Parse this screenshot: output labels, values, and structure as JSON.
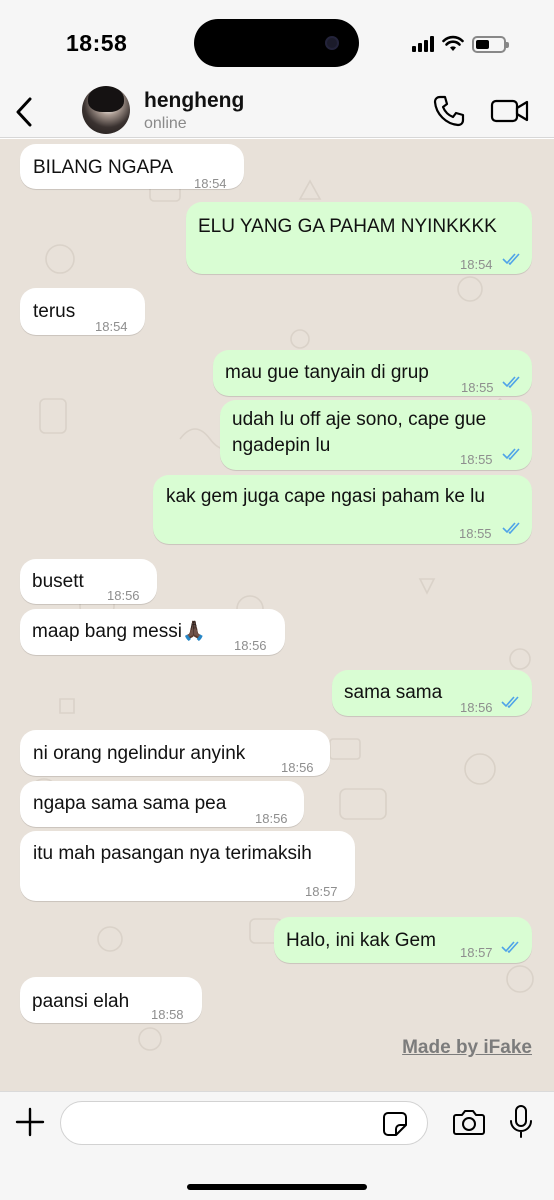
{
  "status_bar": {
    "time": "18:58"
  },
  "header": {
    "contact_name": "hengheng",
    "contact_status": "online"
  },
  "messages": [
    {
      "dir": "in",
      "text": "BILANG NGAPA",
      "time": "18:54"
    },
    {
      "dir": "out",
      "text": "ELU YANG GA PAHAM NYINKKKK",
      "time": "18:54"
    },
    {
      "dir": "in",
      "text": "terus",
      "time": "18:54"
    },
    {
      "dir": "out",
      "text": "mau gue tanyain di grup",
      "time": "18:55"
    },
    {
      "dir": "out",
      "line1": "udah lu off aje sono, cape gue",
      "line2": "ngadepin lu",
      "time": "18:55"
    },
    {
      "dir": "out",
      "text": "kak gem juga cape ngasi paham ke lu",
      "time": "18:55"
    },
    {
      "dir": "in",
      "text": "busett",
      "time": "18:56"
    },
    {
      "dir": "in",
      "text": "maap bang messi🙏🏿",
      "time": "18:56"
    },
    {
      "dir": "out",
      "text": "sama sama",
      "time": "18:56"
    },
    {
      "dir": "in",
      "text": "ni orang ngelindur anyink",
      "time": "18:56"
    },
    {
      "dir": "in",
      "text": "ngapa sama sama pea",
      "time": "18:56"
    },
    {
      "dir": "in",
      "text": "itu mah pasangan nya terimaksih",
      "time": "18:57"
    },
    {
      "dir": "out",
      "text": "Halo, ini kak Gem",
      "time": "18:57"
    },
    {
      "dir": "in",
      "text": "paansi elah",
      "time": "18:58"
    }
  ],
  "watermark": "Made by iFake",
  "input": {
    "value": "",
    "placeholder": ""
  },
  "colors": {
    "incoming_bubble": "#ffffff",
    "outgoing_bubble": "#d9fdd3",
    "chat_background": "#e8e1d9",
    "read_ticks": "#4fa3e8"
  },
  "icons": {
    "back": "chevron-left-icon",
    "call": "phone-icon",
    "video": "video-camera-icon",
    "attach": "plus-icon",
    "sticker": "sticker-icon",
    "camera": "camera-icon",
    "mic": "microphone-icon",
    "read": "double-check-icon"
  }
}
